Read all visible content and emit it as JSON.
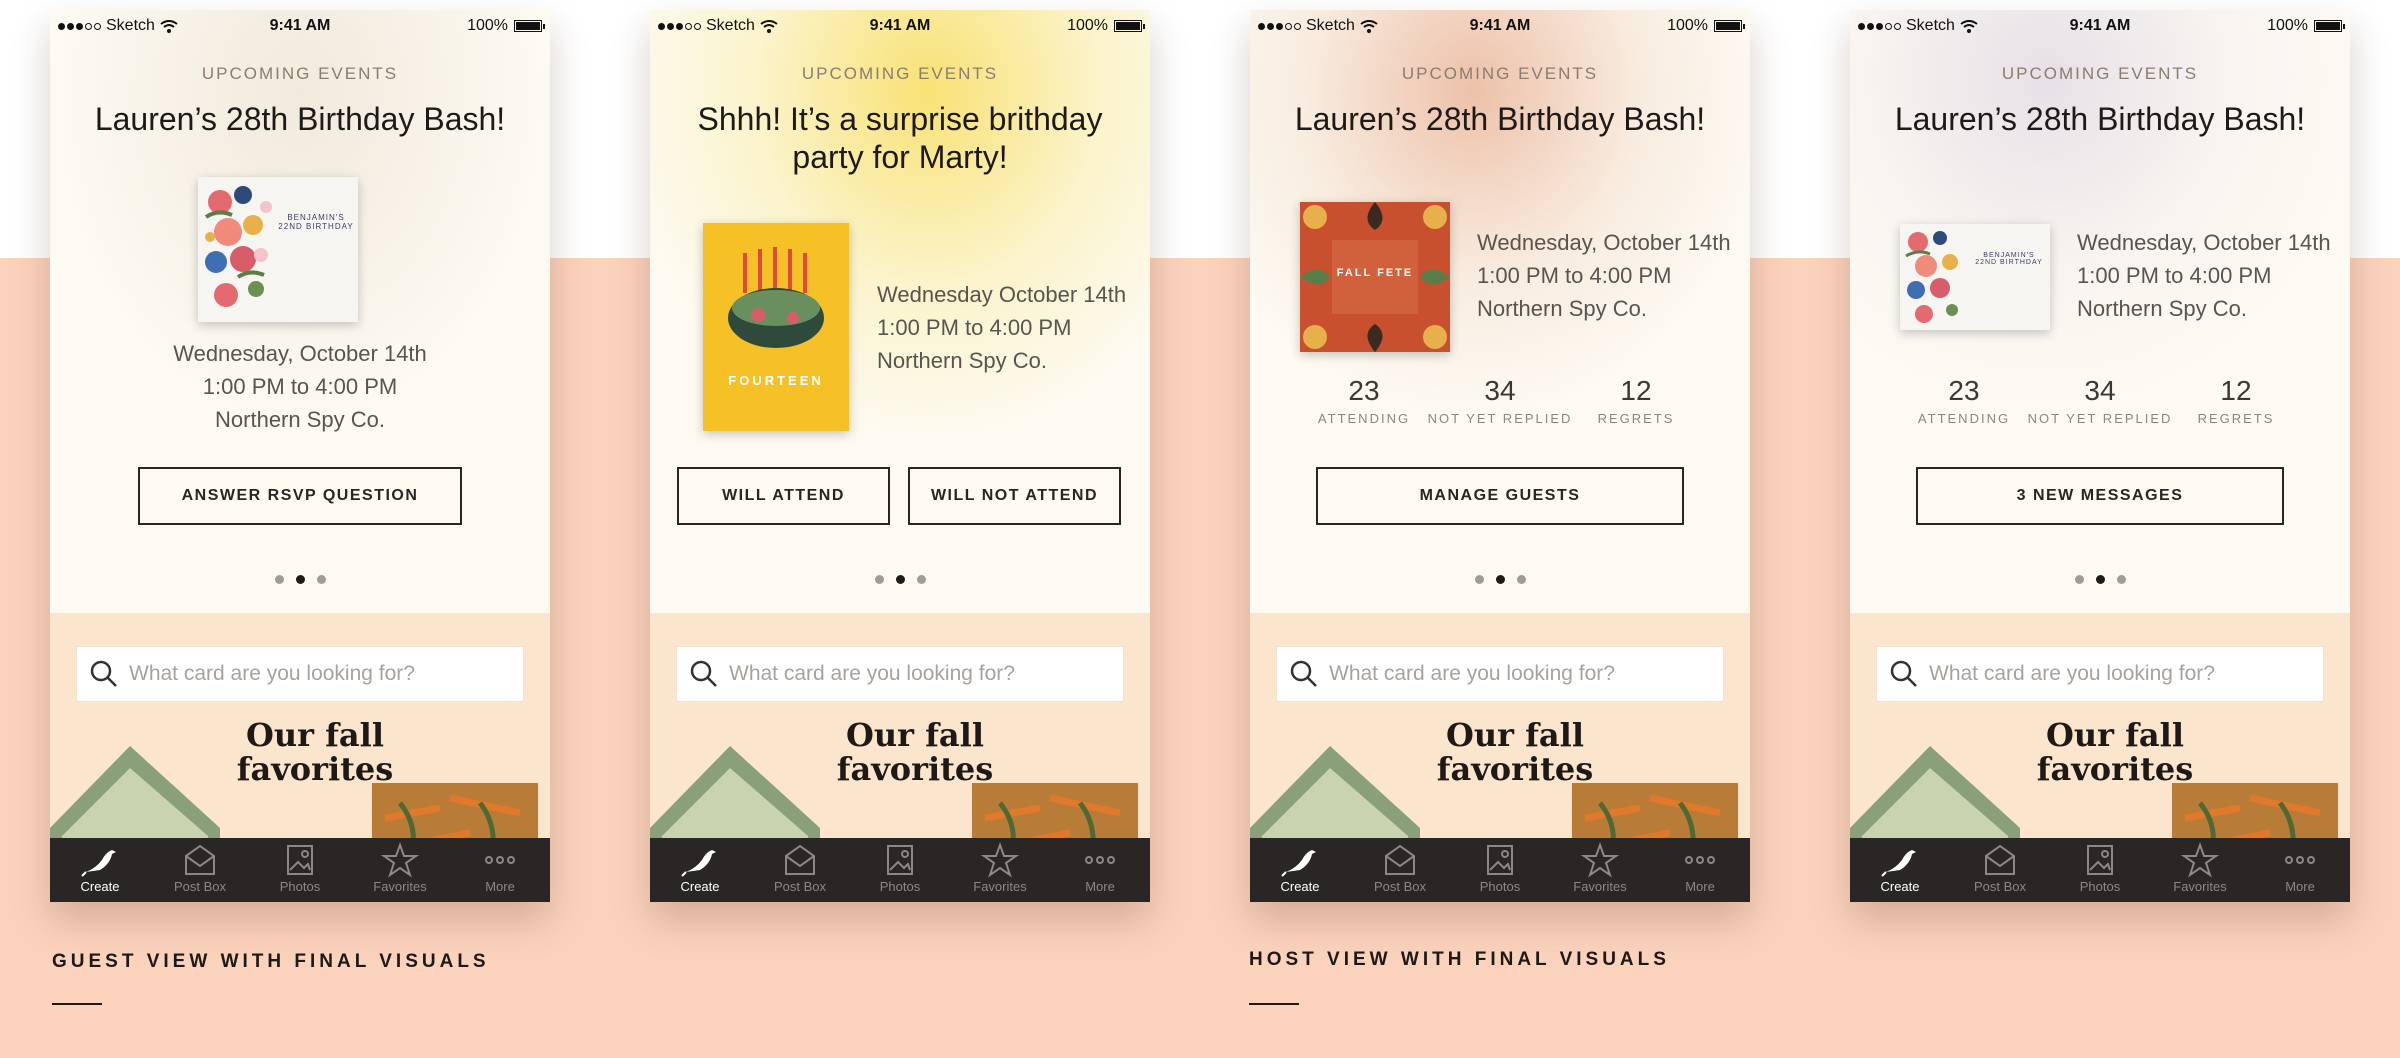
{
  "status_bar": {
    "carrier": "Sketch",
    "time": "9:41 AM",
    "battery": "100%"
  },
  "section_label": "UPCOMING EVENTS",
  "search_placeholder": "What card are you looking for?",
  "promo_title": "Our fall favorites",
  "tabs": [
    "Create",
    "Post Box",
    "Photos",
    "Favorites",
    "More"
  ],
  "colors": {
    "background": "#fbd3bd",
    "panel": "#fdfaf2",
    "tab_bar": "#2a2626",
    "search_area": "#fbe5cd"
  },
  "screens": [
    {
      "title": "Lauren’s 28th Birthday Bash!",
      "card": {
        "line1": "BENJAMIN'S",
        "line2": "22ND BIRTHDAY"
      },
      "details": [
        "Wednesday, October 14th",
        "1:00 PM to 4:00 PM",
        "Northern Spy Co."
      ],
      "buttons": [
        "ANSWER RSVP QUESTION"
      ]
    },
    {
      "title": "Shhh! It’s a surprise brithday party for Marty!",
      "card": {
        "line1": "FOURTEEN"
      },
      "details": [
        "Wednesday October 14th",
        "1:00 PM to 4:00 PM",
        "Northern Spy Co."
      ],
      "buttons": [
        "WILL ATTEND",
        "WILL NOT ATTEND"
      ]
    },
    {
      "title": "Lauren’s 28th Birthday Bash!",
      "card": {
        "line1": "FALL FETE"
      },
      "details": [
        "Wednesday, October 14th",
        "1:00 PM to 4:00 PM",
        "Northern Spy Co."
      ],
      "stats": [
        {
          "value": "23",
          "label": "ATTENDING"
        },
        {
          "value": "34",
          "label": "NOT YET REPLIED"
        },
        {
          "value": "12",
          "label": "REGRETS"
        }
      ],
      "buttons": [
        "MANAGE GUESTS"
      ]
    },
    {
      "title": "Lauren’s 28th Birthday Bash!",
      "card": {
        "line1": "BENJAMIN'S",
        "line2": "22ND BIRTHDAY"
      },
      "details": [
        "Wednesday, October 14th",
        "1:00 PM to 4:00 PM",
        "Northern Spy Co."
      ],
      "stats": [
        {
          "value": "23",
          "label": "ATTENDING"
        },
        {
          "value": "34",
          "label": "NOT YET REPLIED"
        },
        {
          "value": "12",
          "label": "REGRETS"
        }
      ],
      "buttons": [
        "3 NEW MESSAGES"
      ]
    }
  ],
  "captions": {
    "guest": "GUEST VIEW WITH FINAL VISUALS",
    "host": "HOST VIEW WITH FINAL VISUALS"
  }
}
